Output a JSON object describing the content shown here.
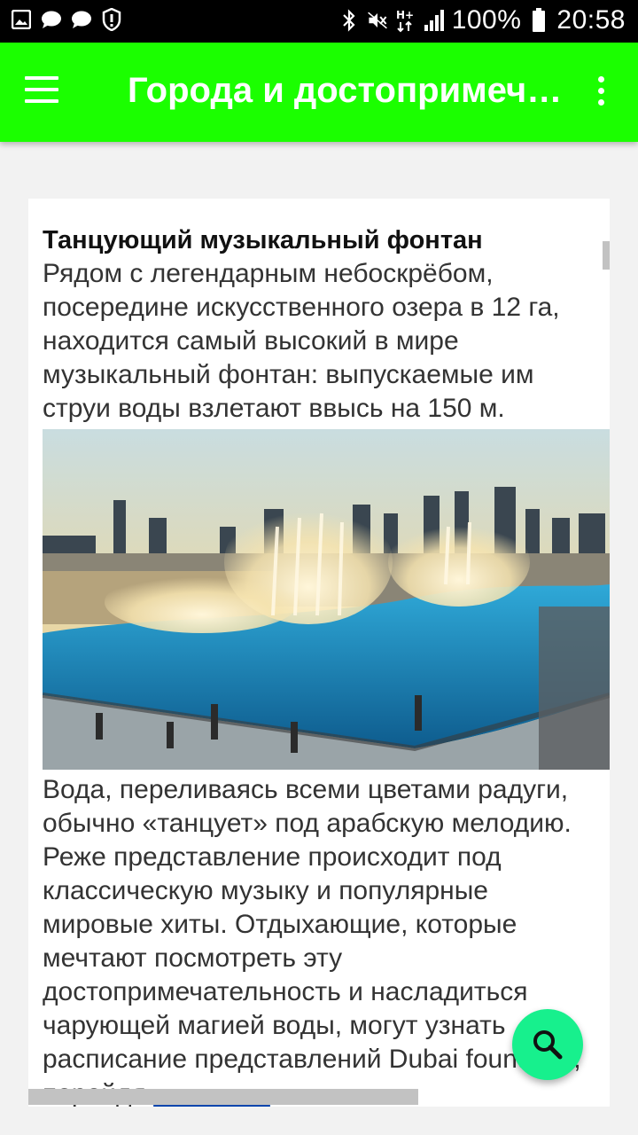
{
  "status_bar": {
    "battery": "100%",
    "time": "20:58",
    "left_icons": [
      "image-icon",
      "chat-icon",
      "chat-icon",
      "alert-shield-icon"
    ],
    "right_icons": [
      "bluetooth-icon",
      "mute-icon",
      "hplus-icon",
      "signal-icon",
      "battery-icon"
    ]
  },
  "app_bar": {
    "title": "Города и достопримечательности",
    "background": "#1bff00"
  },
  "article": {
    "title": "Танцующий музыкальный фонтан",
    "intro": "Рядом с легендарным небоскрёбом, посередине искусственного озера в 12 га, находится самый высокий в мире музыкальный фонтан: выпускаемые им струи воды взлетают ввысь на 150 м.",
    "body": "Вода, переливаясь всеми цветами радуги, обычно «танцует» под арабскую мелодию. Реже представление происходит под классическую музыку и популярные мировые хиты. Отдыхающие, которые мечтают посмотреть эту достопримечательность и насладиться чарующей магией воды, могут узнать расписание представлений Dubai fountains, перейдя ",
    "link_text": "по ссылке",
    "after_link": "."
  },
  "fab": {
    "icon": "search-icon",
    "color": "#17f08d"
  }
}
